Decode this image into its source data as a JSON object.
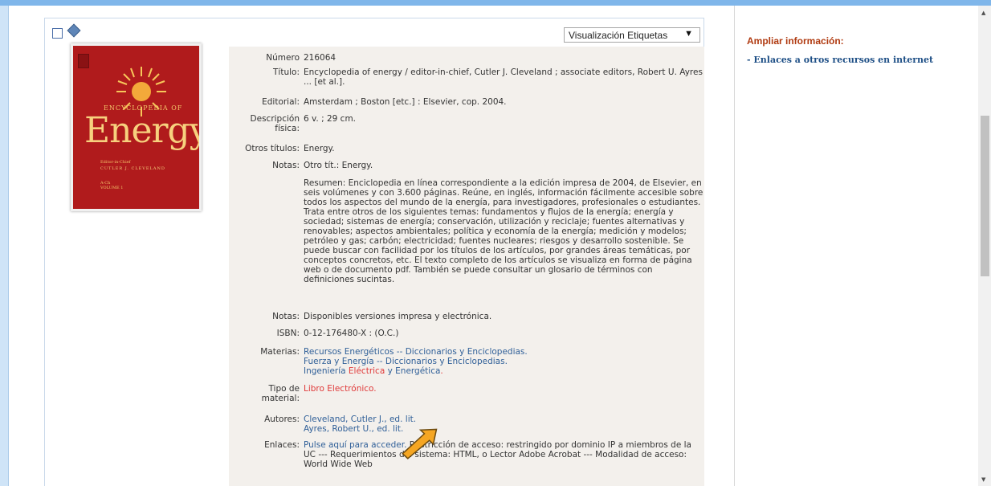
{
  "view_select": {
    "value": "Visualización Etiquetas"
  },
  "cover": {
    "small_title": "ENCYCLOPEDIA OF",
    "big_title": "Energy",
    "editor": "Editor-in-Chief",
    "editor_name": "CUTLER J. CLEVELAND",
    "volume": "A-Ch",
    "volume_no": "VOLUME 1"
  },
  "record": {
    "numero": {
      "label": "Número",
      "value": "216064"
    },
    "titulo": {
      "label": "Título:",
      "value": "Encyclopedia of energy / editor-in-chief, Cutler J. Cleveland ; associate editors, Robert U. Ayres ... [et al.]."
    },
    "editorial": {
      "label": "Editorial:",
      "value": "Amsterdam ; Boston [etc.] : Elsevier, cop. 2004."
    },
    "descripcion": {
      "label": "Descripción física:",
      "value": "6 v. ; 29 cm."
    },
    "otros_titulos": {
      "label": "Otros títulos:",
      "value": "Energy."
    },
    "notas1": {
      "label": "Notas:",
      "value": "Otro tít.: Energy."
    },
    "resumen": "Resumen: Enciclopedia en línea correspondiente a la edición impresa de 2004, de Elsevier, en seis volúmenes y con 3.600 páginas. Reúne, en inglés, información fácilmente accesible sobre todos los aspectos del mundo de la energía, para investigadores, profesionales o estudiantes. Trata entre otros de los siguientes temas: fundamentos y flujos de la energía; energía y sociedad; sistemas de energía; conservación, utilización y reciclaje; fuentes alternativas y renovables; aspectos ambientales; política y economía de la energía; medición y modelos; petróleo y gas; carbón; electricidad; fuentes nucleares; riesgos y desarrollo sostenible. Se puede buscar con facilidad por los títulos de los artículos, por grandes áreas temáticas, por conceptos concretos, etc. El texto completo de los artículos se visualiza en forma de página web o de documento pdf. También se puede consultar un glosario de términos con definiciones sucintas.",
    "notas2": {
      "label": "Notas:",
      "value": "Disponibles versiones impresa y electrónica."
    },
    "isbn": {
      "label": "ISBN:",
      "value": "0-12-176480-X : (O.C.)"
    },
    "materias": {
      "label": "Materias:",
      "line1": "Recursos Energéticos -- Diccionarios y Enciclopedias.",
      "line2": "Fuerza y Energía -- Diccionarios y Enciclopedias.",
      "line3_a": "Ingeniería",
      "line3_b": "Eléctrica",
      "line3_c": "y Energética",
      "line3_d": "."
    },
    "tipo": {
      "label": "Tipo de material:",
      "value": "Libro Electrónico."
    },
    "autores": {
      "label": "Autores:",
      "a1": "Cleveland, Cutler J., ed. lit.",
      "a2": "Ayres, Robert U., ed. lit."
    },
    "enlaces": {
      "label": "Enlaces:",
      "link": "Pulse aquí para acceder.",
      "text": "Restricción de acceso: restringido por dominio IP a miembros de la UC --- Requerimientos del sistema: HTML, o Lector Adobe Acrobat --- Modalidad de acceso: World Wide Web"
    }
  },
  "sidebar": {
    "heading": "Ampliar información:",
    "link": "- Enlaces a otros recursos en internet"
  },
  "colors": {
    "accent": "#b03a10",
    "link": "#2f5f98",
    "red_link": "#e03a3a",
    "annotation": "#f5a623"
  },
  "icons": [
    "checkbox-icon",
    "diamond-icon",
    "dropdown-arrow-icon",
    "annotation-arrow-icon"
  ]
}
